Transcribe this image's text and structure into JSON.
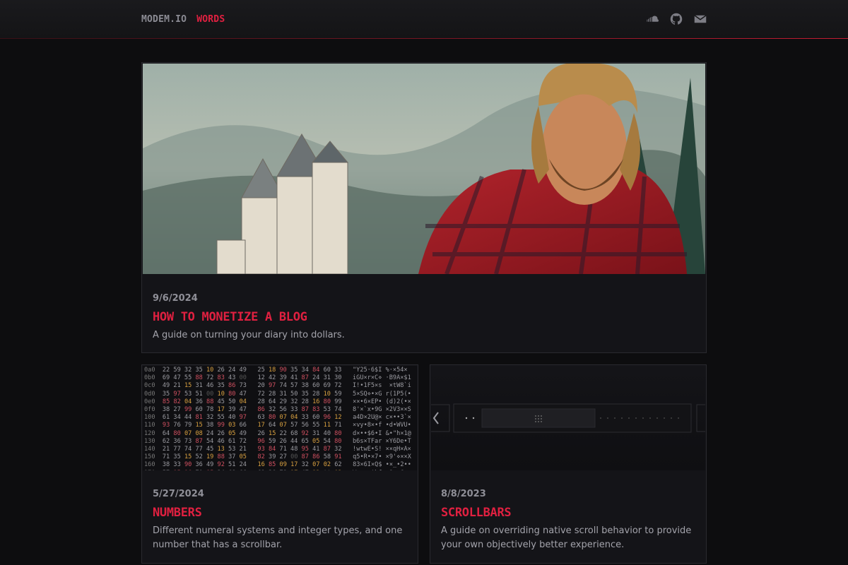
{
  "nav": {
    "brand": "MODEM.IO",
    "words": "WORDS"
  },
  "icons": [
    "soundcloud-icon",
    "github-icon",
    "mail-icon"
  ],
  "colors": {
    "accent": "#e02040",
    "background": "#0d0d0f",
    "card": "#141418"
  },
  "posts": [
    {
      "date": "9/6/2024",
      "title": "HOW TO MONETIZE A BLOG",
      "description": "A guide on turning your diary into dollars."
    },
    {
      "date": "5/27/2024",
      "title": "NUMBERS",
      "description": "Different numeral systems and integer types, and one number that has a scrollbar."
    },
    {
      "date": "8/8/2023",
      "title": "SCROLLBARS",
      "description": "A guide on overriding native scroll behavior to provide your own objectively better experience."
    }
  ]
}
